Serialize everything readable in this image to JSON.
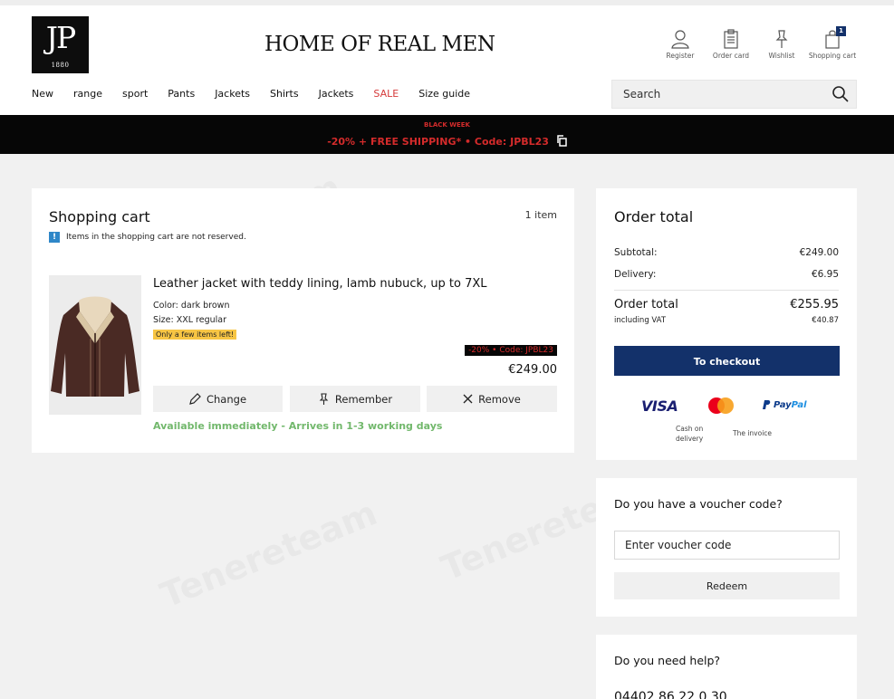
{
  "brand": {
    "logo_mono": "JP",
    "logo_year": "1880",
    "slogan": "HOME OF REAL MEN"
  },
  "header_icons": [
    {
      "label": "Register",
      "icon": "user-icon"
    },
    {
      "label": "Order card",
      "icon": "clipboard-icon"
    },
    {
      "label": "Wishlist",
      "icon": "pin-icon"
    },
    {
      "label": "Shopping cart",
      "icon": "bag-icon",
      "badge": "1"
    }
  ],
  "nav": [
    "New",
    "range",
    "sport",
    "Pants",
    "Jackets",
    "Shirts",
    "Jackets",
    "SALE",
    "Size guide"
  ],
  "search": {
    "placeholder": "Search"
  },
  "promo": {
    "small": "BLACK WEEK",
    "big": "-20% + FREE SHIPPING* • Code: JPBL23"
  },
  "cart": {
    "title": "Shopping cart",
    "count": "1 item",
    "notice": "Items in the shopping cart are not reserved.",
    "item": {
      "name": "Leather jacket with teddy lining, lamb nubuck, up to 7XL",
      "color": "Color: dark brown",
      "size": "Size: XXL regular",
      "stock_badge": "Only a few items left!",
      "discount_tag": "-20% • Code: JPBL23",
      "price": "€249.00",
      "availability": "Available immediately - Arrives in 1-3 working days"
    },
    "actions": {
      "change": "Change",
      "remember": "Remember",
      "remove": "Remove"
    }
  },
  "order": {
    "title": "Order total",
    "subtotal_label": "Subtotal:",
    "subtotal_value": "€249.00",
    "delivery_label": "Delivery:",
    "delivery_value": "€6.95",
    "total_label": "Order total",
    "total_value": "€255.95",
    "vat_label": "including VAT",
    "vat_value": "€40.87",
    "checkout": "To checkout",
    "payments": {
      "visa": "VISA",
      "paypal_a": "Pay",
      "paypal_b": "Pal",
      "cash_line1": "Cash on",
      "cash_line2": "delivery",
      "invoice": "The invoice"
    }
  },
  "voucher": {
    "title": "Do you have a voucher code?",
    "placeholder": "Enter voucher code",
    "redeem": "Redeem"
  },
  "help": {
    "title": "Do you need help?",
    "phone": "04402 86 22 0 30"
  },
  "colors": {
    "navy": "#13316a",
    "sale_red": "#d53a3a",
    "promo_red": "#d42b2b",
    "availability_green": "#72b86c",
    "badge_yellow": "#f7c544"
  }
}
